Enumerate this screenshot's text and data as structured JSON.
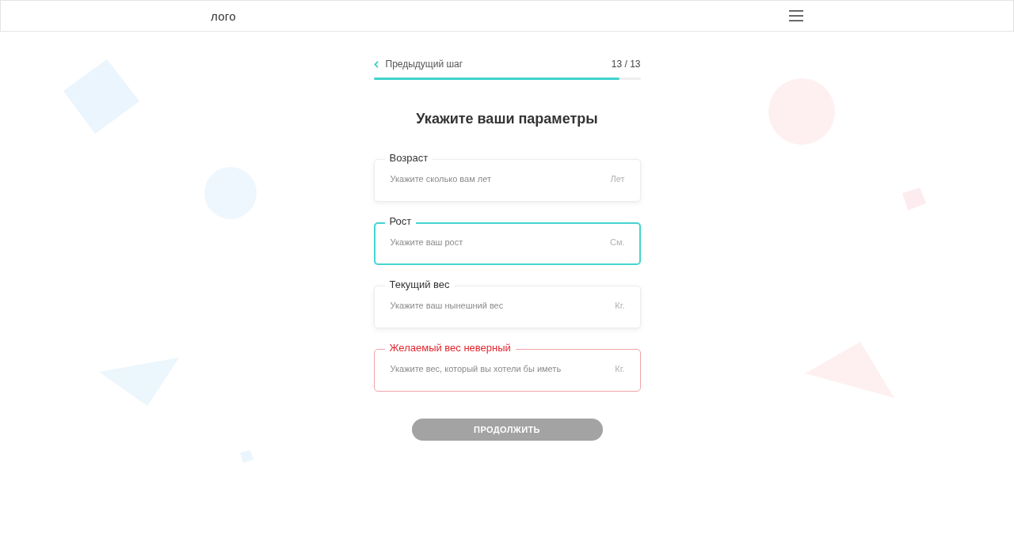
{
  "header": {
    "logo": "лого"
  },
  "step_nav": {
    "back_label": "Предыдущий шаг",
    "counter": "13 / 13",
    "progress": {
      "level": 0.92
    }
  },
  "title": "Укажите ваши параметры",
  "fields": [
    {
      "label": "Возраст",
      "placeholder": "Укажите сколько вам лет",
      "unit": "Лет",
      "focused": false,
      "invalid": false
    },
    {
      "label": "Рост",
      "placeholder": "Укажите ваш рост",
      "unit": "См.",
      "focused": true,
      "invalid": false
    },
    {
      "label": "Текущий вес",
      "placeholder": "Укажите ваш нынешний вес",
      "unit": "Кг.",
      "focused": false,
      "invalid": false
    },
    {
      "label": "Желаемый вес неверный",
      "placeholder": "Укажите вес, который вы хотели бы иметь",
      "unit": "Кг.",
      "focused": false,
      "invalid": true
    }
  ],
  "continue_button": {
    "label": "ПРОДОЛЖИТЬ",
    "disabled": true
  }
}
